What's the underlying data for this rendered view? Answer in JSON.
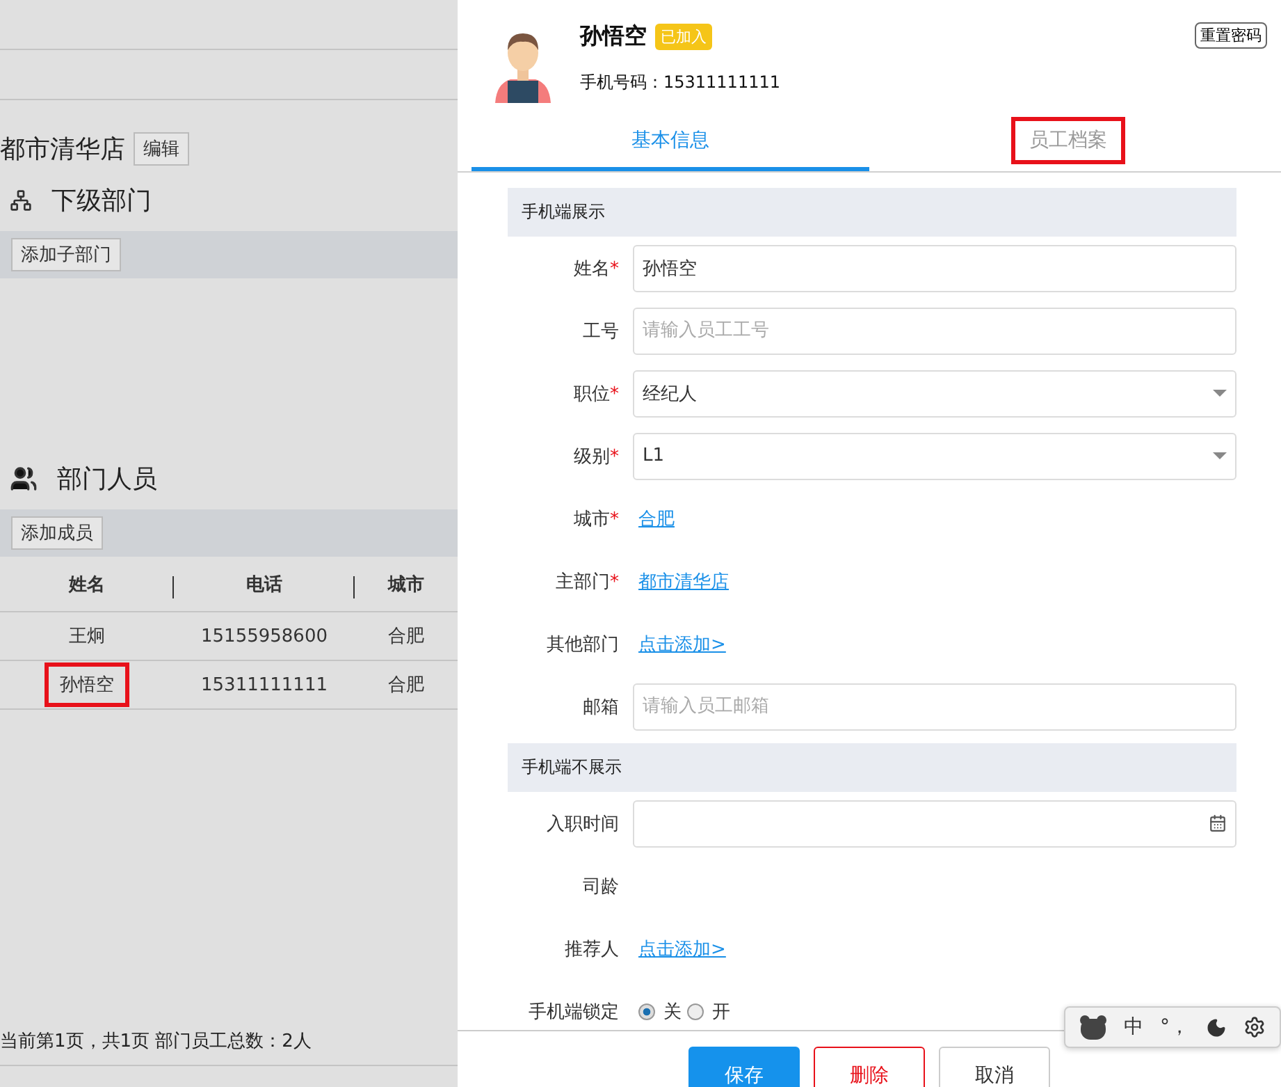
{
  "department": {
    "name": "都市清华店",
    "edit_button": "编辑"
  },
  "sub_departments": {
    "title": "下级部门",
    "add_button": "添加子部门"
  },
  "members": {
    "title": "部门人员",
    "add_button": "添加成员",
    "columns": [
      "姓名",
      "电话",
      "城市"
    ],
    "rows": [
      {
        "cells": [
          "王炯",
          "15155958600",
          "合肥"
        ],
        "annotated": false
      },
      {
        "cells": [
          "孙悟空",
          "15311111111",
          "合肥"
        ],
        "annotated": true
      }
    ],
    "footer": "当前第1页，共1页 部门员工总数：2人"
  },
  "profile": {
    "name": "孙悟空",
    "badge": "已加入",
    "phone": "手机号码：15311111111",
    "reset_button": "重置密码"
  },
  "tabs": [
    {
      "label": "基本信息",
      "selected": true,
      "annotated": false
    },
    {
      "label": "员工档案",
      "selected": false,
      "annotated": true
    }
  ],
  "sections": [
    {
      "title": "手机端展示",
      "fields": [
        {
          "label": "姓名",
          "required": true,
          "kind": "input",
          "value": "孙悟空"
        },
        {
          "label": "工号",
          "required": false,
          "kind": "input",
          "placeholder": "请输入员工工号"
        },
        {
          "label": "职位",
          "required": true,
          "kind": "select",
          "value": "经纪人"
        },
        {
          "label": "级别",
          "required": true,
          "kind": "select",
          "value": "L1"
        },
        {
          "label": "城市",
          "required": true,
          "kind": "link",
          "value": "合肥"
        },
        {
          "label": "主部门",
          "required": true,
          "kind": "link",
          "value": "都市清华店"
        },
        {
          "label": "其他部门",
          "required": false,
          "kind": "link",
          "value": "点击添加>"
        },
        {
          "label": "邮箱",
          "required": false,
          "kind": "input",
          "placeholder": "请输入员工邮箱"
        }
      ]
    },
    {
      "title": "手机端不展示",
      "fields": [
        {
          "label": "入职时间",
          "required": false,
          "kind": "date"
        },
        {
          "label": "司龄",
          "required": false,
          "kind": "text"
        },
        {
          "label": "推荐人",
          "required": false,
          "kind": "link",
          "value": "点击添加>"
        },
        {
          "label": "手机端锁定",
          "required": false,
          "kind": "radio",
          "options": [
            {
              "label": "关",
              "selected": true
            },
            {
              "label": "开",
              "selected": false
            }
          ]
        }
      ]
    }
  ],
  "required_mark": "*",
  "buttons": [
    {
      "label": "保存",
      "kind": "primary"
    },
    {
      "label": "删除",
      "kind": "danger"
    },
    {
      "label": "取消",
      "kind": "default"
    }
  ],
  "ime_toolbar": {
    "mode": "中",
    "punct": "°，"
  }
}
